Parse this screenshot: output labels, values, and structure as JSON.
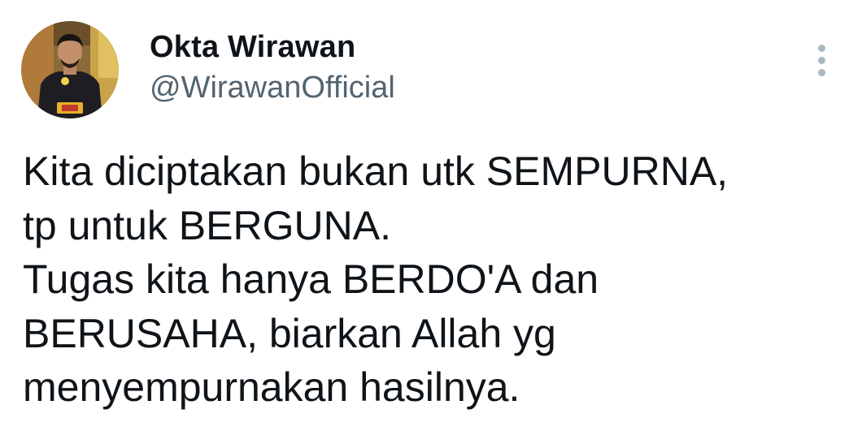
{
  "author": {
    "display_name": "Okta Wirawan",
    "handle": "@WirawanOfficial",
    "avatar_icon": "profile-photo"
  },
  "more_icon": "vertical-ellipsis-icon",
  "tweet": {
    "lines": [
      "Kita diciptakan bukan utk SEMPURNA,",
      "tp untuk BERGUNA.",
      "Tugas kita hanya BERDO'A dan",
      "BERUSAHA, biarkan Allah yg",
      "menyempurnakan hasilnya."
    ]
  },
  "colors": {
    "text": "#0f1419",
    "secondary_text": "#536471",
    "icon": "#aab8c2",
    "background": "#ffffff"
  }
}
